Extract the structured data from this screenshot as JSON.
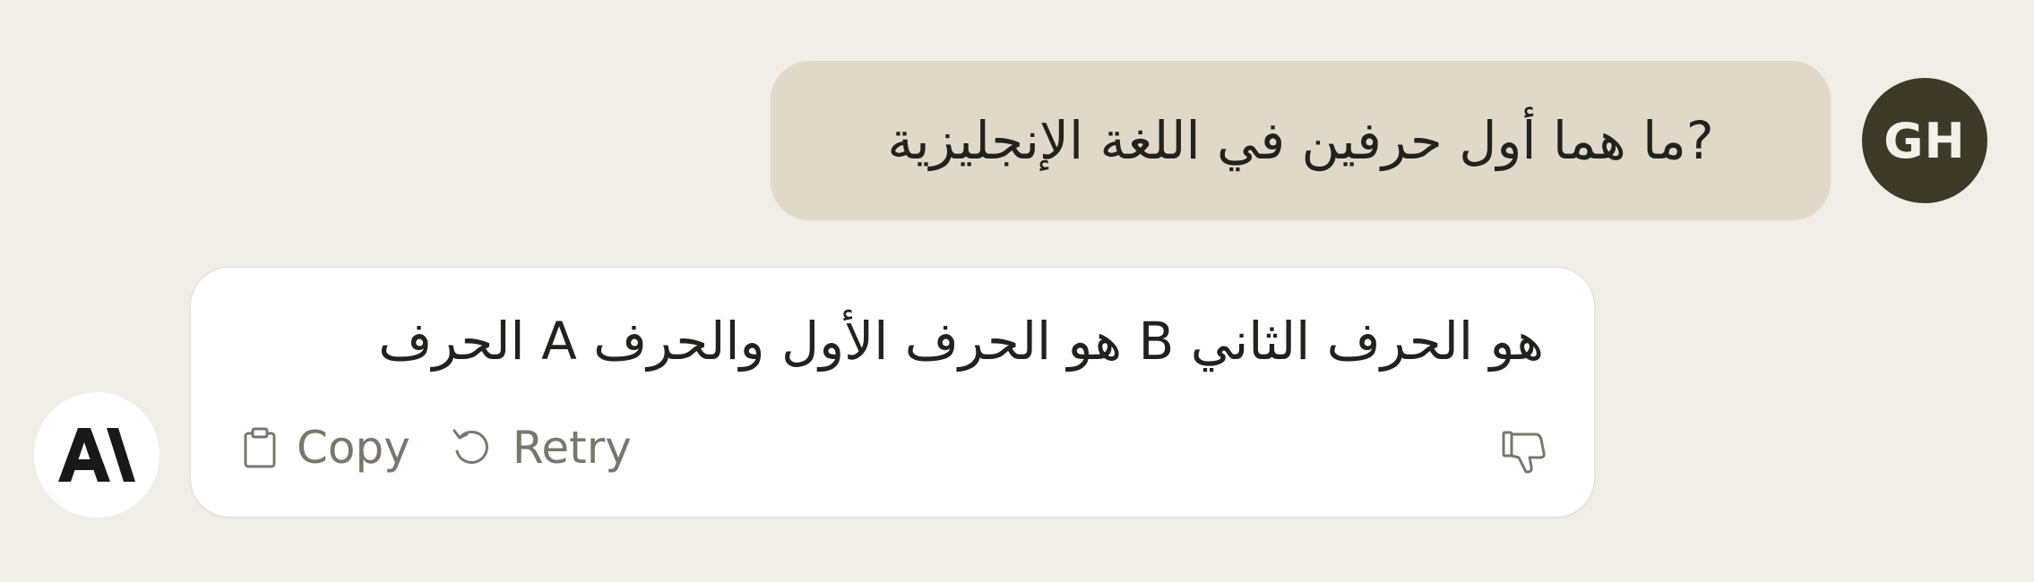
{
  "user_message": {
    "avatar_initials": "GH",
    "text": "?ما هما أول حرفين في اللغة الإنجليزية"
  },
  "assistant_message": {
    "text": "هو الحرف الثاني B هو الحرف الأول والحرف A الحرف",
    "actions": {
      "copy_label": "Copy",
      "retry_label": "Retry"
    },
    "icons": {
      "copy": "clipboard-icon",
      "retry": "retry-icon",
      "feedback": "thumbs-down-icon",
      "avatar": "anthropic-logo-icon"
    }
  },
  "colors": {
    "background": "#f0eee6",
    "user_bubble": "#e0d8c9",
    "user_avatar": "#3d3a29",
    "assistant_card": "#ffffff",
    "text": "#23211d",
    "muted": "#7b766c"
  }
}
